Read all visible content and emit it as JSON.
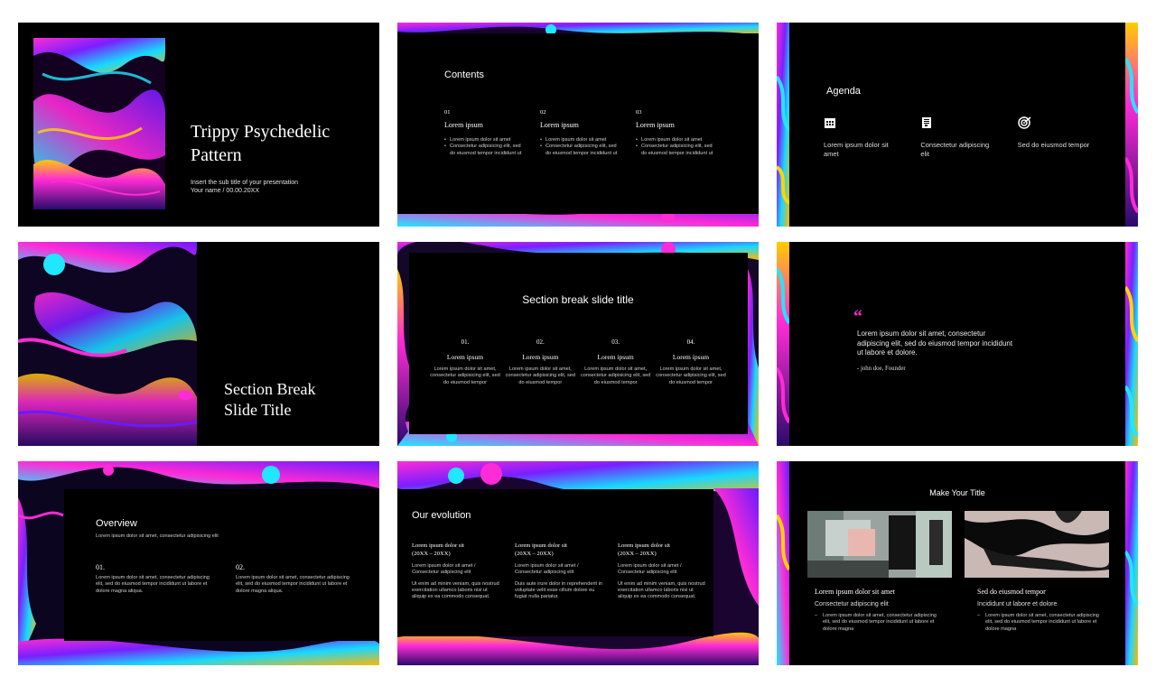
{
  "slide1": {
    "title_line1": "Trippy Psychedelic",
    "title_line2": "Pattern",
    "subtitle": "Insert the sub title of your presentation",
    "author": "Your name / 00.00.20XX"
  },
  "slide2": {
    "heading": "Contents",
    "items": [
      {
        "num": "01",
        "title": "Lorem ipsum",
        "bullets": [
          "Lorem ipsum dolor sit amet",
          "Consectetur adipisicing elit, sed do eiusmod tempor incididunt ut"
        ]
      },
      {
        "num": "02",
        "title": "Lorem ipsum",
        "bullets": [
          "Lorem ipsum dolor sit amet",
          "Consectetur adipisicing elit, sed do eiusmod tempor incididunt ut"
        ]
      },
      {
        "num": "03",
        "title": "Lorem ipsum",
        "bullets": [
          "Lorem ipsum dolor sit amet",
          "Consectetur adipisicing elit, sed do eiusmod tempor incididunt ut"
        ]
      }
    ]
  },
  "slide3": {
    "heading": "Agenda",
    "items": [
      {
        "icon": "calendar-icon",
        "text": "Lorem ipsum dolor sit amet"
      },
      {
        "icon": "document-icon",
        "text": "Consectetur adipiscing elit"
      },
      {
        "icon": "target-icon",
        "text": "Sed do eiusmod tempor"
      }
    ]
  },
  "slide4": {
    "title_line1": "Section Break",
    "title_line2": "Slide Title"
  },
  "slide5": {
    "title": "Section break slide title",
    "items": [
      {
        "num": "01.",
        "title": "Lorem ipsum",
        "text": "Lorem ipsum dolor sit amet, consectetur adipisicing elit, sed do eiusmod tempor"
      },
      {
        "num": "02.",
        "title": "Lorem ipsum",
        "text": "Lorem ipsum dolor sit amet, consectetur adipisicing elit, sed do eiusmod tempor"
      },
      {
        "num": "03.",
        "title": "Lorem ipsum",
        "text": "Lorem ipsum dolor sit amet, consectetur adipisicing elit, sed do eiusmod tempor"
      },
      {
        "num": "04.",
        "title": "Lorem ipsum",
        "text": "Lorem ipsum dolor sit amet, consectetur adipisicing elit, sed do eiusmod tempor"
      }
    ]
  },
  "slide6": {
    "quote_mark": "“",
    "quote": "Lorem ipsum dolor sit amet, consectetur adipiscing elit, sed do eiusmod tempor incididunt ut labore et dolore.",
    "author": "- john doe, Founder"
  },
  "slide7": {
    "heading": "Overview",
    "subtitle": "Lorem ipsum dolor sit amet, consectetur adipisicing elit",
    "items": [
      {
        "num": "01.",
        "text": "Lorem ipsum dolor sit amet, consectetur adipiscing elit, sed do eiusmod tempor incididunt ut labore et dolore magna aliqua."
      },
      {
        "num": "02.",
        "text": "Lorem ipsum dolor sit amet, consectetur adipiscing elit, sed do eiusmod tempor incididunt ut labore et dolore magna aliqua."
      }
    ]
  },
  "slide8": {
    "heading": "Our evolution",
    "columns": [
      {
        "title": "Lorem ipsum dolor sit",
        "range": "(20XX – 20XX)",
        "sub": "Lorem ipsum dolor sit amet / Consectetur adipiscing elit",
        "body": "Ut enim ad minim veniam, quis nostrud exercitation ullamco laboris nisi ut aliquip ex ea commodo consequat."
      },
      {
        "title": "Lorem ipsum dolor sit",
        "range": "(20XX – 20XX)",
        "sub": "Lorem ipsum dolor sit amet / Consectetur adipiscing elit",
        "body": "Duis aute irure dolor in reprehenderit in voluptate velit esse cillum dolore eu fugiat nulla pariatur."
      },
      {
        "title": "Lorem ipsum dolor sit",
        "range": "(20XX – 20XX)",
        "sub": "Lorem ipsum dolor sit amet / Consectetur adipiscing elit",
        "body": "Ut enim ad minim veniam, quis nostrud exercitation ullamco laboris nisi ut aliquip ex ea commodo consequat."
      }
    ]
  },
  "slide9": {
    "heading": "Make Your Title",
    "cards": [
      {
        "title": "Lorem ipsum dolor sit amet",
        "sub": "Consectetur adipiscing elit",
        "text": "Lorem ipsum dolor sit amet, consectetur adipiscing elit, sed do eiusmod tempor incididunt ut labore et dolore magna"
      },
      {
        "title": "Sed do eiusmod tempor",
        "sub": "Incididunt ut labore et dolore",
        "text": "Lorem ipsum dolor sit amet, consectetur adipiscing elit, sed do eiusmod tempor incididunt ut labore et dolore magna"
      }
    ]
  },
  "colors": {
    "background": "#000000",
    "accent_magenta": "#ff2bd6",
    "accent_cyan": "#21e6ff",
    "accent_purple": "#8a2be2"
  }
}
